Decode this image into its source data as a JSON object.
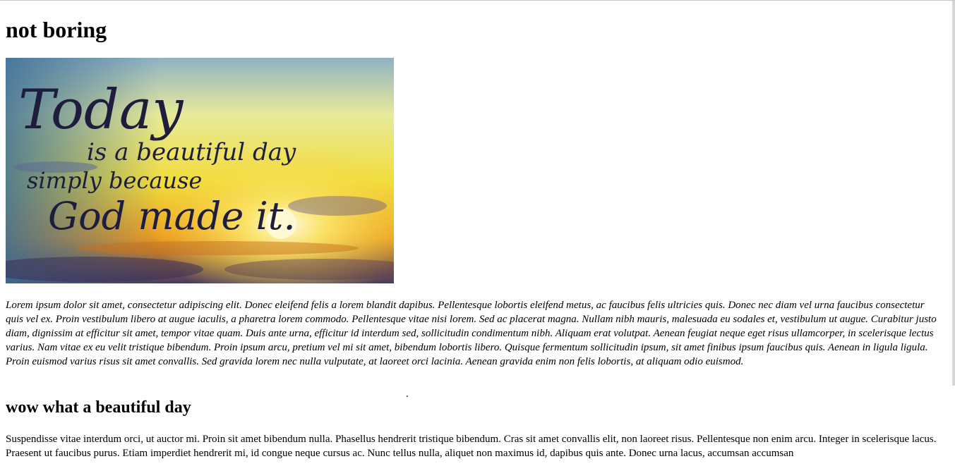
{
  "page": {
    "title": "not boring",
    "hero_image": {
      "line1": "Today",
      "line2": "is a beautiful day",
      "line3": "simply because",
      "line4": "God made it."
    },
    "intro_paragraph": "Lorem ipsum dolor sit amet, consectetur adipiscing elit. Donec eleifend felis a lorem blandit dapibus. Pellentesque lobortis eleifend metus, ac faucibus felis ultricies quis. Donec nec diam vel urna faucibus consectetur quis vel ex. Proin vestibulum libero at augue iaculis, a pharetra lorem commodo. Pellentesque vitae nisi lorem. Sed ac placerat magna. Nullam nibh mauris, malesuada eu sodales et, vestibulum ut augue. Curabitur justo diam, dignissim at efficitur sit amet, tempor vitae quam. Duis ante urna, efficitur id interdum sed, sollicitudin condimentum nibh. Aliquam erat volutpat. Aenean feugiat neque eget risus ullamcorper, in scelerisque lectus varius. Nam vitae ex eu velit tristique bibendum. Proin ipsum arcu, pretium vel mi sit amet, bibendum lobortis libero. Quisque fermentum sollicitudin ipsum, sit amet finibus ipsum faucibus quis. Aenean in ligula ligula. Proin euismod varius risus sit amet convallis. Sed gravida lorem nec nulla vulputate, at laoreet orci lacinia. Aenean gravida enim non felis lobortis, at aliquam odio euismod.",
    "separator_dot": ".",
    "subheading": "wow what a beautiful day",
    "second_paragraph": "Suspendisse vitae interdum orci, ut auctor mi. Proin sit amet bibendum nulla. Phasellus hendrerit tristique bibendum. Cras sit amet convallis elit, non laoreet risus. Pellentesque non enim arcu. Integer in scelerisque lacus. Praesent ut faucibus purus. Etiam imperdiet hendrerit mi, id congue neque cursus ac. Nunc tellus nulla, aliquet non maximus id, dapibus quis ante. Donec urna lacus, accumsan accumsan"
  }
}
